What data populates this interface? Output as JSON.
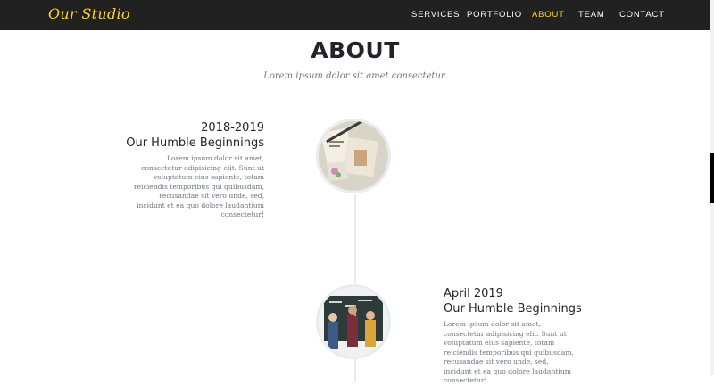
{
  "brand": "Our Studio",
  "nav": [
    "SERVICES",
    "PORTFOLIO",
    "ABOUT",
    "TEAM",
    "CONTACT"
  ],
  "active_nav": "ABOUT",
  "colors": {
    "accent": "#fed136",
    "navbar": "#212121",
    "text": "#212529",
    "muted": "#6c757d"
  },
  "section": {
    "title": "ABOUT",
    "subtitle": "Lorem ipsum dolor sit amet consectetur."
  },
  "timeline": [
    {
      "date": "2018-2019",
      "heading": "Our Humble Beginnings",
      "body": "Lorem ipsum dolor sit amet, consectetur adipisicing elit. Sunt ut voluptatum eius sapiente, totam reiciendis temporibus qui quibusdam, recusandae sit vero unde, sed, incidunt et ea quo dolore laudantium consectetur!",
      "image": "desk-photo"
    },
    {
      "date": "April 2019",
      "heading": "Our Humble Beginnings",
      "body": "Lorem ipsum dolor sit amet, consectetur adipisicing elit. Sunt ut voluptatum eius sapiente, totam reiciendis temporibus qui quibusdam, recusandae sit vero unde, sed, incidunt et ea quo dolore laudantium consectetur!",
      "image": "team-chalkboard-photo"
    }
  ]
}
